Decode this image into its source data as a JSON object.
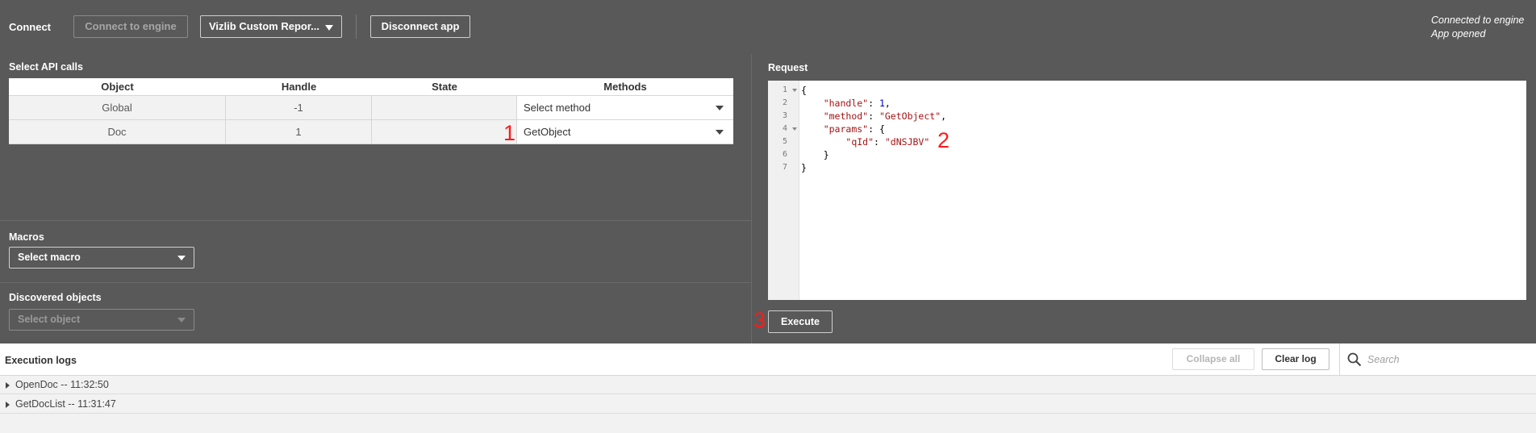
{
  "toolbar": {
    "label": "Connect",
    "connect_engine": "Connect to engine",
    "app_select": "Vizlib Custom Repor...",
    "disconnect": "Disconnect app",
    "status_line1": "Connected to engine",
    "status_line2": "App opened"
  },
  "api": {
    "title": "Select API calls",
    "columns": [
      "Object",
      "Handle",
      "State",
      "Methods"
    ],
    "rows": [
      {
        "object": "Global",
        "handle": "-1",
        "state": "",
        "method": "Select method"
      },
      {
        "object": "Doc",
        "handle": "1",
        "state": "",
        "method": "GetObject"
      }
    ]
  },
  "macros": {
    "title": "Macros",
    "select": "Select macro"
  },
  "discovered": {
    "title": "Discovered objects",
    "select": "Select object"
  },
  "request": {
    "title": "Request",
    "line_numbers": [
      "1",
      "2",
      "3",
      "4",
      "5",
      "6",
      "7"
    ],
    "execute": "Execute",
    "code": {
      "l1": "{",
      "handle_key": "\"handle\"",
      "handle_val": "1",
      "method_key": "\"method\"",
      "method_val": "\"GetObject\"",
      "params_key": "\"params\"",
      "qid_key": "\"qId\"",
      "qid_val": "\"dNSJBV\"",
      "l6": "    }",
      "l7": "}"
    }
  },
  "annotations": [
    "1",
    "2",
    "3"
  ],
  "logs": {
    "title": "Execution logs",
    "collapse_all": "Collapse all",
    "clear_log": "Clear log",
    "search_placeholder": "Search",
    "entries": [
      "OpenDoc -- 11:32:50",
      "GetDocList -- 11:31:47"
    ]
  },
  "colors": {
    "background": "#595959",
    "annotation": "#ff1a1a"
  }
}
